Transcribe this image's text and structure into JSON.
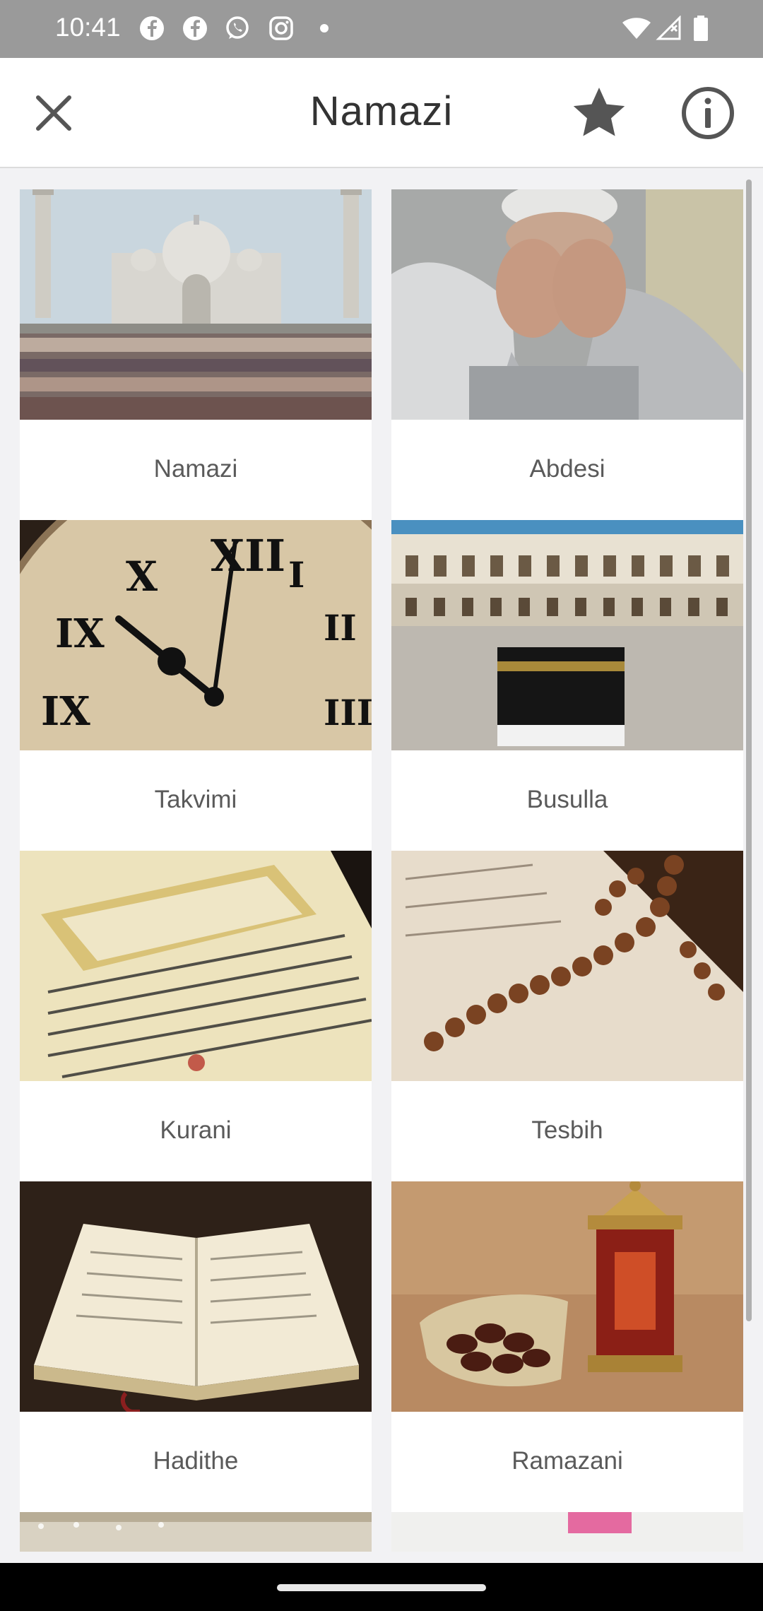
{
  "status_bar": {
    "time": "10:41",
    "left_icons": [
      "facebook-icon",
      "facebook-icon",
      "whatsapp-icon",
      "instagram-icon",
      "dot-icon"
    ],
    "right_icons": [
      "wifi-icon",
      "signal-icon",
      "battery-icon"
    ]
  },
  "app_bar": {
    "title": "Namazi",
    "close_icon": "close-icon",
    "favorite_icon": "star-icon",
    "info_icon": "info-icon"
  },
  "grid": {
    "items": [
      {
        "label": "Namazi",
        "image": "mosque-prayer-crowd"
      },
      {
        "label": "Abdesi",
        "image": "child-ablution"
      },
      {
        "label": "Takvimi",
        "image": "clock-face"
      },
      {
        "label": "Busulla",
        "image": "kaaba-mecca"
      },
      {
        "label": "Kurani",
        "image": "quran-pages"
      },
      {
        "label": "Tesbih",
        "image": "prayer-beads"
      },
      {
        "label": "Hadithe",
        "image": "open-book"
      },
      {
        "label": "Ramazani",
        "image": "dates-lantern"
      }
    ]
  },
  "colors": {
    "status_bar": "#9a9a9a",
    "app_bar": "#ffffff",
    "background": "#f2f2f4",
    "label_text": "#5a5a5a",
    "title_text": "#333333"
  }
}
